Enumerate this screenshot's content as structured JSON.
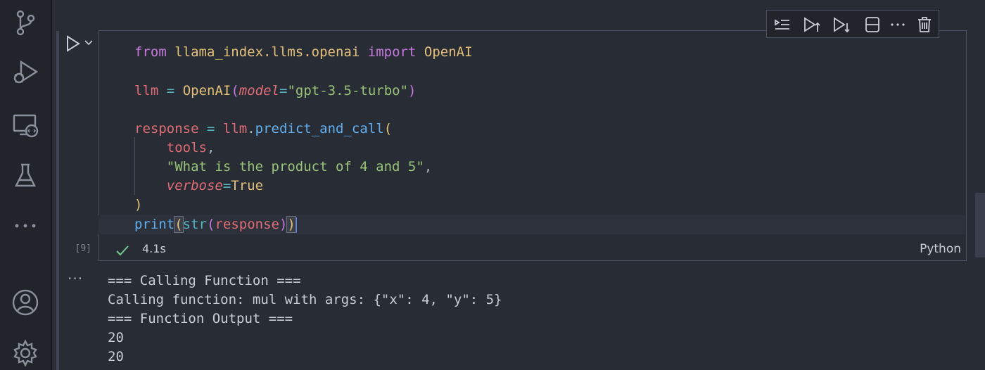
{
  "activity_bar": {
    "icons": [
      "source-control-icon",
      "run-debug-icon",
      "remote-explorer-icon",
      "testing-icon",
      "more-icon",
      "account-icon",
      "settings-icon"
    ],
    "more_label": "···"
  },
  "cell": {
    "execution_count": "[9]",
    "status_time": "4.1s",
    "language": "Python",
    "code": {
      "l1": {
        "kw_from": "from",
        "module": "llama_index.llms.openai",
        "kw_import": "import",
        "cls": "OpenAI"
      },
      "l2": {
        "var": "llm",
        "op": "=",
        "cls": "OpenAI",
        "p_open": "(",
        "param": "model",
        "eq": "=",
        "str": "\"gpt-3.5-turbo\"",
        "p_close": ")"
      },
      "l3": {
        "var": "response",
        "op": "=",
        "obj": "llm",
        "dot": ".",
        "fn": "predict_and_call",
        "p_open": "("
      },
      "l4": {
        "arg": "tools",
        "comma": ","
      },
      "l5": {
        "str": "\"What is the product of 4 and 5\"",
        "comma": ","
      },
      "l6": {
        "param": "verbose",
        "eq": "=",
        "bool": "True"
      },
      "l7": {
        "p_close": ")"
      },
      "l8": {
        "fn": "print",
        "p1": "(",
        "builtin": "str",
        "p2": "(",
        "arg": "response",
        "p3": ")",
        "p4": ")"
      }
    }
  },
  "output": {
    "menu": "···",
    "lines": [
      "=== Calling Function ===",
      "Calling function: mul with args: {\"x\": 4, \"y\": 5}",
      "=== Function Output ===",
      "20",
      "20"
    ]
  },
  "colors": {
    "background": "#282c34",
    "keyword": "#c678dd",
    "string": "#98c379",
    "function": "#61afef",
    "variable": "#e06c75",
    "class": "#e5c07b",
    "success": "#73c991"
  }
}
